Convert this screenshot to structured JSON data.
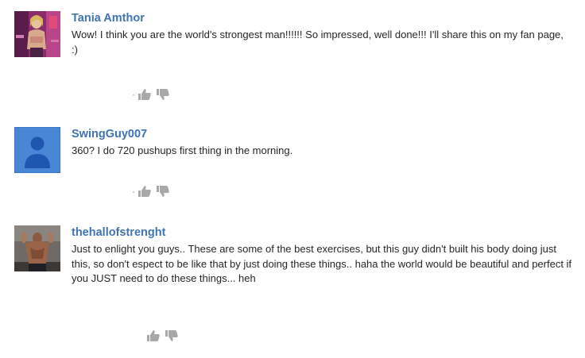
{
  "comments": [
    {
      "author": "Tania Amthor",
      "text": "Wow! I think you are the world's strongest man!!!!!! So impressed, well done!!! I'll share this on my fan page, :)",
      "show_dot": true
    },
    {
      "author": "SwingGuy007",
      "text": "360?  I do 720 pushups first thing in the morning.",
      "show_dot": true
    },
    {
      "author": "thehallofstrenght",
      "text": "Just to enlight you guys.. These are some of the best exercises, but this guy didn't built his body doing just this, so don't espect to be like that by just doing these things.. haha the world would be beautiful and perfect if you JUST need to do these things... heh",
      "show_dot": false
    }
  ],
  "ui": {
    "dot": "·",
    "upvote_icon": "thumbs-up-icon",
    "downvote_icon": "thumbs-down-icon",
    "default_avatar_color": "#4a86d6",
    "author_color": "#3f74b4",
    "vote_icon_color": "#a8a8a8"
  }
}
